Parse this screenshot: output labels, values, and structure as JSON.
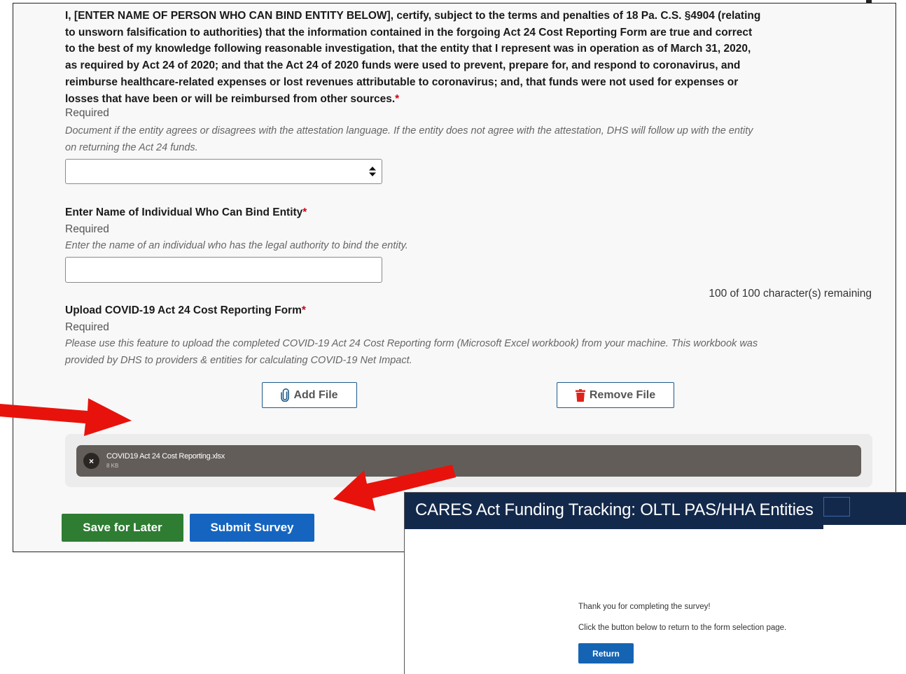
{
  "form": {
    "attestation": {
      "text": "I, [ENTER NAME OF PERSON WHO CAN BIND ENTITY BELOW], certify, subject to the terms and penalties of 18 Pa. C.S. §4904 (relating to unsworn falsification to authorities) that the information contained in the forgoing Act 24 Cost Reporting Form are true and correct to the best of my knowledge following reasonable investigation, that the entity that I represent was in operation as of March 31, 2020, as required by Act 24 of 2020; and that the Act 24 of 2020 funds were used to prevent, prepare for, and respond to coronavirus, and reimburse healthcare-related expenses or lost revenues attributable to coronavirus; and, that funds were not used for expenses or losses that have been or will be reimbursed from other sources.",
      "required_marker": "*",
      "required_label": "Required",
      "help": "Document if the entity agrees or disagrees with the attestation language. If the entity does not agree with the attestation, DHS will follow up with the entity on returning the Act 24 funds.",
      "select_value": ""
    },
    "binder_name": {
      "label": "Enter Name of Individual Who Can Bind Entity",
      "required_marker": "*",
      "required_label": "Required",
      "help": "Enter the name of an individual who has the legal authority to bind the entity.",
      "value": "",
      "char_count": "100 of 100 character(s) remaining"
    },
    "upload": {
      "label": "Upload COVID-19 Act 24 Cost Reporting Form",
      "required_marker": "*",
      "required_label": "Required",
      "help": "Please use this feature to upload the completed COVID-19 Act 24 Cost Reporting form (Microsoft Excel workbook) from your machine. This workbook was provided by DHS to providers & entities for calculating COVID-19 Net Impact.",
      "add_label": "Add File",
      "remove_label": "Remove File",
      "file_name": "COVID19 Act 24 Cost Reporting.xlsx",
      "file_size": "8 KB",
      "file_close": "×"
    },
    "actions": {
      "save_label": "Save for Later",
      "submit_label": "Submit Survey"
    }
  },
  "confirmation": {
    "title": "CARES Act Funding Tracking: OLTL PAS/HHA Entities",
    "thanks": "Thank you for completing the survey!",
    "instruction": "Click the button below to return to the form selection page.",
    "return_label": "Return"
  },
  "icons": {
    "select_arrow": "sort-icon",
    "add_file": "paperclip-icon",
    "remove_file": "trash-icon",
    "annotation_arrows": "red-arrow-icon"
  },
  "colors": {
    "required": "#d0021b",
    "save_button": "#2e7d32",
    "submit_button": "#1565c0",
    "confirm_header": "#13294b",
    "return_button": "#1564b3",
    "remove_icon": "#e0231a",
    "arrow": "#e8120c"
  }
}
